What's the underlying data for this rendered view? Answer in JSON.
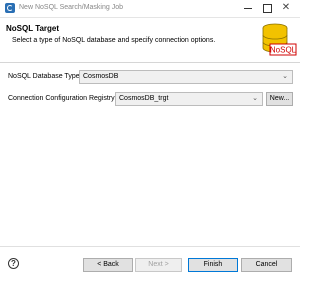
{
  "window": {
    "title": "New NoSQL Search/Masking Job",
    "minimize_icon": "minimize-icon",
    "maximize_icon": "maximize-icon",
    "close_glyph": "✕"
  },
  "header": {
    "title": "NoSQL Target",
    "description": "Select a type of NoSQL database and specify connection options.",
    "icon_label": "NoSQL",
    "icon_colors": {
      "cylinder": "#f2c200",
      "label_bg": "#ffffff",
      "label_text": "#d00000"
    }
  },
  "form": {
    "db_type_label": "NoSQL Database Type:",
    "db_type_value": "CosmosDB",
    "registry_label": "Connection Configuration Registry:",
    "registry_value": "CosmosDB_trgt",
    "new_button": "New..."
  },
  "footer": {
    "help_glyph": "?",
    "back": "< Back",
    "next": "Next >",
    "finish": "Finish",
    "cancel": "Cancel"
  }
}
